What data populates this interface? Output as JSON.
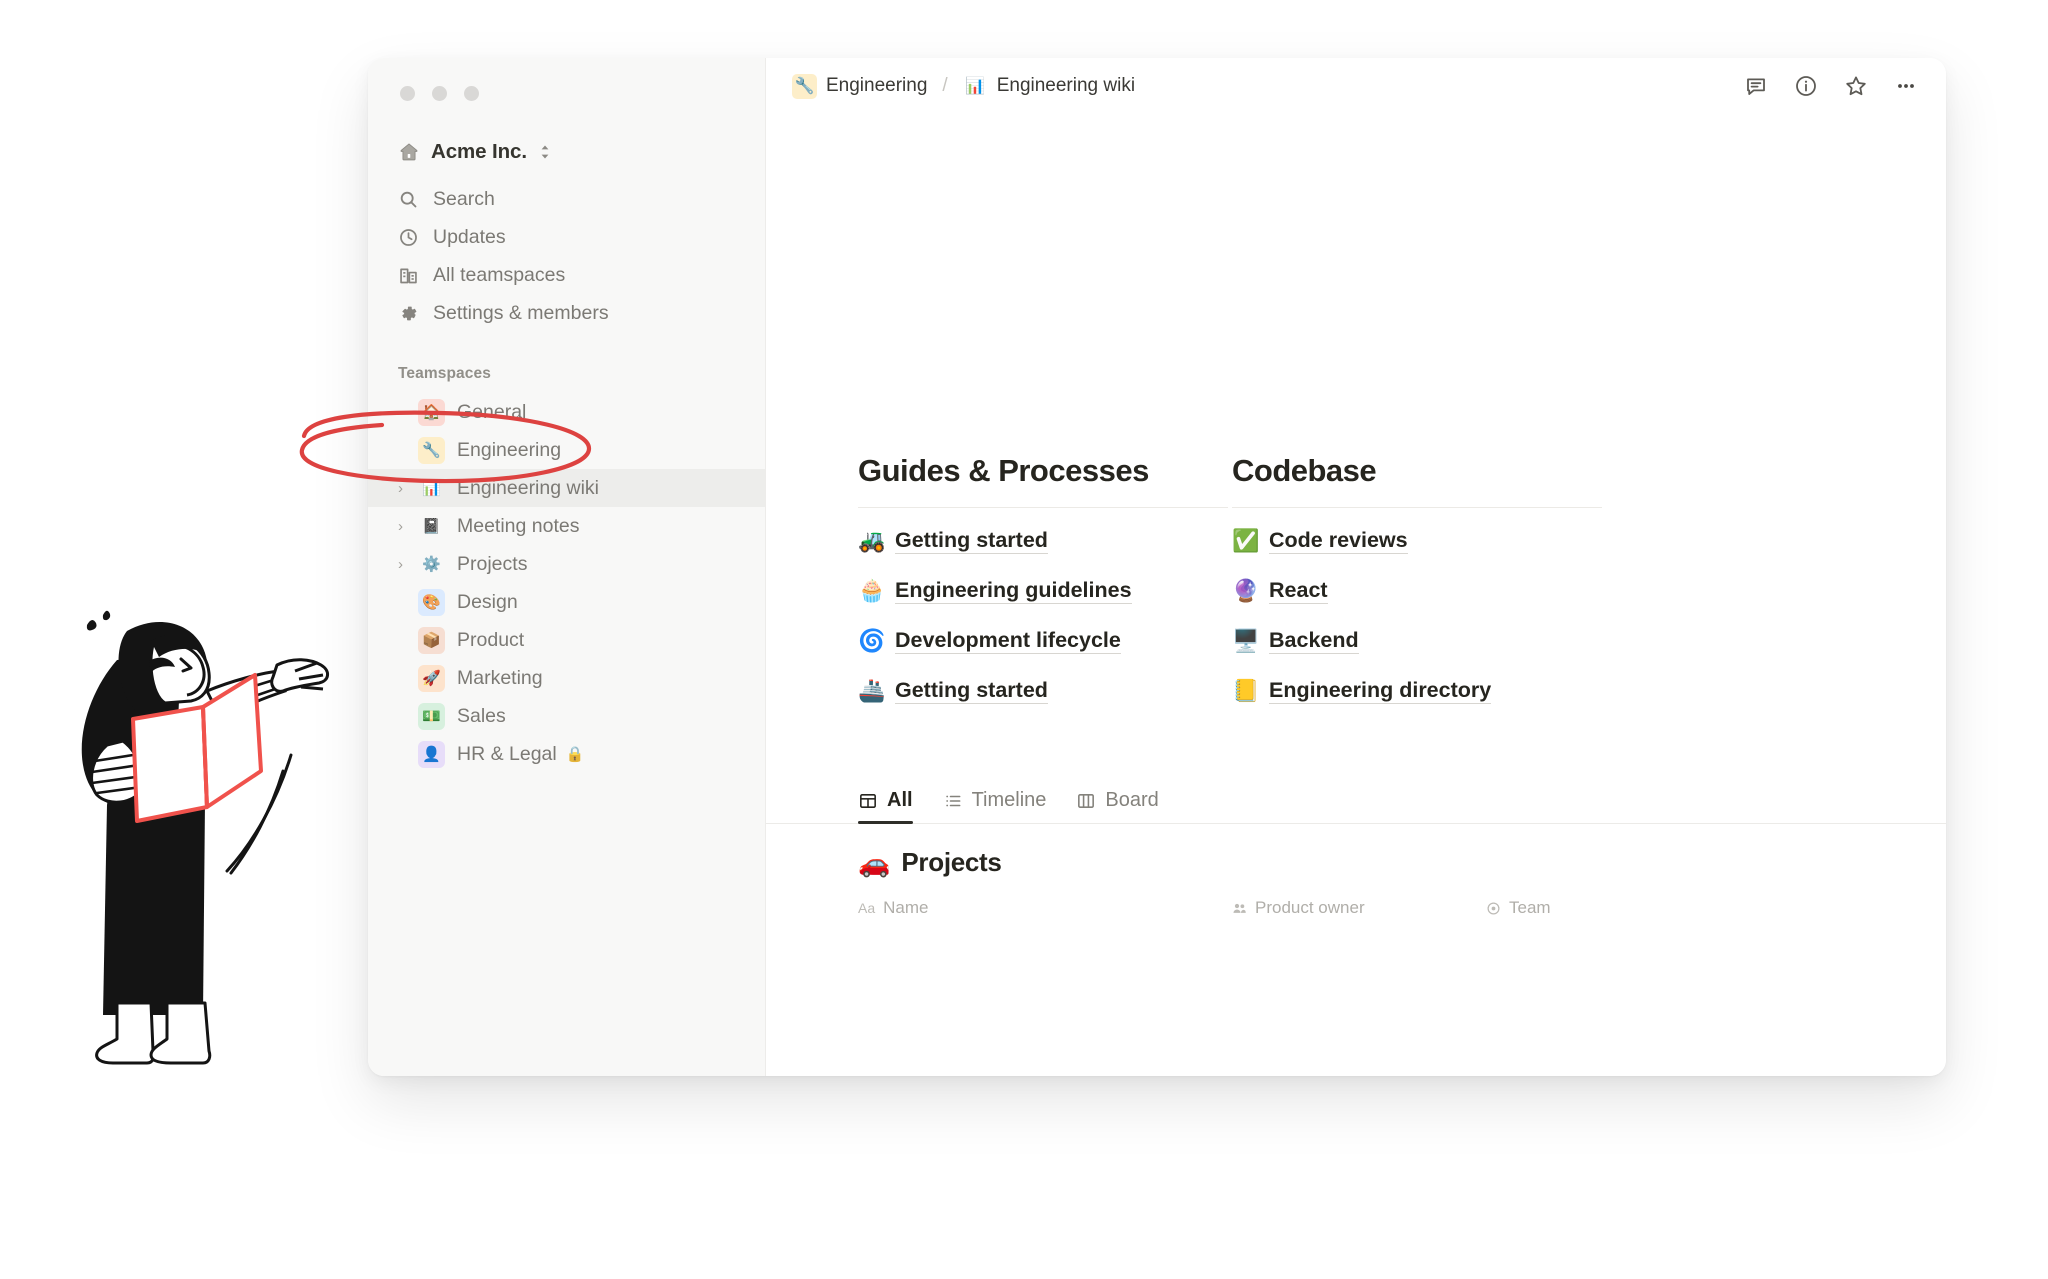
{
  "window": {
    "traffic_lights": [
      "close",
      "minimize",
      "zoom"
    ]
  },
  "sidebar": {
    "workspace": {
      "name": "Acme Inc.",
      "icon": "house-icon",
      "switcher_icon": "chevron-updown-icon"
    },
    "nav": [
      {
        "label": "Search",
        "icon": "search-icon"
      },
      {
        "label": "Updates",
        "icon": "clock-icon"
      },
      {
        "label": "All teamspaces",
        "icon": "buildings-icon"
      },
      {
        "label": "Settings & members",
        "icon": "gear-icon"
      }
    ],
    "section_label": "Teamspaces",
    "teamspaces": [
      {
        "label": "General",
        "emoji": "🏠",
        "badge_color": "#fbd9d3",
        "expandable": false,
        "selected": false,
        "locked": false
      },
      {
        "label": "Engineering",
        "emoji": "🔧",
        "badge_color": "#fdeec9",
        "expandable": false,
        "selected": false,
        "locked": false
      },
      {
        "label": "Engineering wiki",
        "emoji": "📊",
        "badge_color": "#ffffff",
        "expandable": true,
        "selected": true,
        "locked": false
      },
      {
        "label": "Meeting notes",
        "emoji": "📓",
        "badge_color": "#ffffff",
        "expandable": true,
        "selected": false,
        "locked": false
      },
      {
        "label": "Projects",
        "emoji": "⚙️",
        "badge_color": "#ffffff",
        "expandable": true,
        "selected": false,
        "locked": false
      },
      {
        "label": "Design",
        "emoji": "🎨",
        "badge_color": "#dbeafe",
        "expandable": false,
        "selected": false,
        "locked": false
      },
      {
        "label": "Product",
        "emoji": "📦",
        "badge_color": "#f6ded2",
        "expandable": false,
        "selected": false,
        "locked": false
      },
      {
        "label": "Marketing",
        "emoji": "🚀",
        "badge_color": "#fde3cc",
        "expandable": false,
        "selected": false,
        "locked": false
      },
      {
        "label": "Sales",
        "emoji": "💵",
        "badge_color": "#d7f0de",
        "expandable": false,
        "selected": false,
        "locked": false
      },
      {
        "label": "HR & Legal",
        "emoji": "👤",
        "badge_color": "#e7ddf9",
        "expandable": false,
        "selected": false,
        "locked": true,
        "lock_emoji": "🔒"
      }
    ]
  },
  "topbar": {
    "breadcrumb": [
      {
        "label": "Engineering",
        "emoji": "🔧",
        "badge_color": "#fdeec9"
      },
      {
        "label": "Engineering wiki",
        "emoji": "📊",
        "badge_color": "#ffffff"
      }
    ],
    "separator": "/",
    "actions": [
      {
        "name": "comment-icon"
      },
      {
        "name": "info-icon"
      },
      {
        "name": "star-icon"
      },
      {
        "name": "more-icon"
      }
    ]
  },
  "content": {
    "columns": [
      {
        "heading": "Guides & Processes",
        "links": [
          {
            "label": "Getting started",
            "emoji": "🚜"
          },
          {
            "label": "Engineering guidelines",
            "emoji": "🧁"
          },
          {
            "label": "Development lifecycle",
            "emoji": "🌀"
          },
          {
            "label": "Getting started",
            "emoji": "🚢"
          }
        ]
      },
      {
        "heading": "Codebase",
        "links": [
          {
            "label": "Code reviews",
            "emoji": "✅"
          },
          {
            "label": "React",
            "emoji": "🔮"
          },
          {
            "label": "Backend",
            "emoji": "🖥️"
          },
          {
            "label": "Engineering directory",
            "emoji": "📒"
          }
        ]
      }
    ],
    "view_tabs": [
      {
        "label": "All",
        "icon": "table-icon",
        "active": true
      },
      {
        "label": "Timeline",
        "icon": "timeline-icon",
        "active": false
      },
      {
        "label": "Board",
        "icon": "board-icon",
        "active": false
      }
    ],
    "database": {
      "emoji": "🚗",
      "title": "Projects",
      "columns": [
        {
          "label": "Name",
          "type_icon": "Aa"
        },
        {
          "label": "Product owner",
          "type_icon": "person-icon"
        },
        {
          "label": "Team",
          "type_icon": "select-icon"
        }
      ]
    }
  },
  "annotation": {
    "shape": "ellipse",
    "color": "#e0413f",
    "target": "Engineering wiki"
  },
  "illustration": {
    "name": "person-reading-book",
    "book_color": "#f4645e"
  }
}
